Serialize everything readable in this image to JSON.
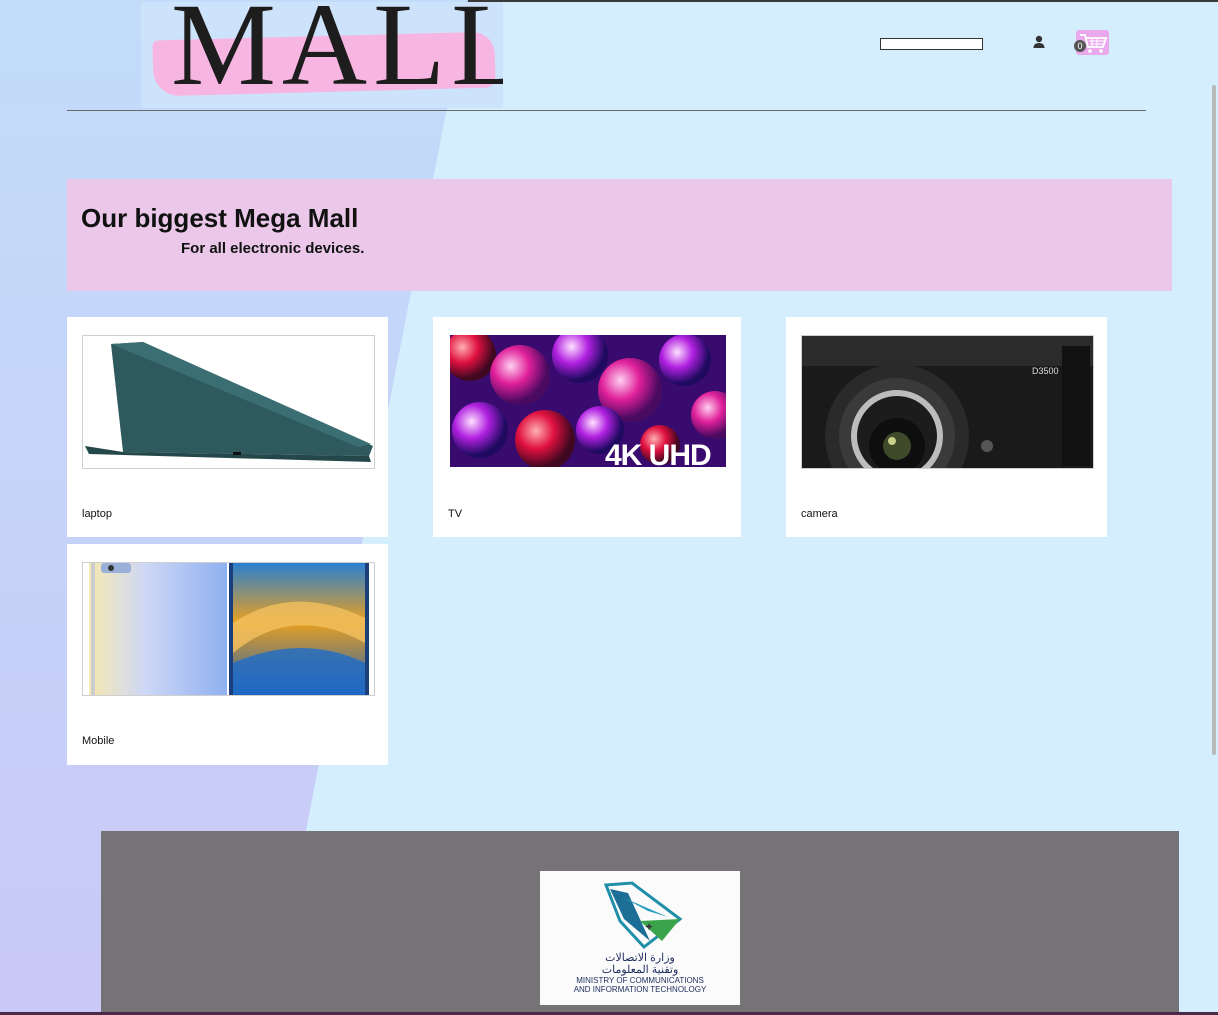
{
  "brand": {
    "logo_text": "MALL"
  },
  "header": {
    "search": {
      "value": "",
      "placeholder": ""
    },
    "account_icon": "user-icon",
    "cart": {
      "icon": "cart-icon",
      "count": "0"
    }
  },
  "hero": {
    "title": "Our biggest Mega Mall",
    "subtitle": "For all electronic devices."
  },
  "products": [
    {
      "label": "laptop",
      "image": "laptop-image"
    },
    {
      "label": "TV",
      "image": "tv-4k-uhd-image",
      "image_text": "4K UHD"
    },
    {
      "label": "camera",
      "image": "dslr-camera-image",
      "image_text": "D3500"
    },
    {
      "label": "Mobile",
      "image": "mobile-phones-image"
    }
  ],
  "footer": {
    "logo": {
      "arabic_line1": "وزارة الاتصالات",
      "arabic_line2": "وتقنية المعلومات",
      "english_line1": "MINISTRY OF COMMUNICATIONS",
      "english_line2": "AND INFORMATION TECHNOLOGY"
    }
  },
  "colors": {
    "page_bg": "#d4eefd",
    "hero_bg": "#ebc8e9",
    "logo_brush": "#f7b6e1",
    "cart_bg": "#e9a9ec",
    "footer_bg": "#757376"
  }
}
